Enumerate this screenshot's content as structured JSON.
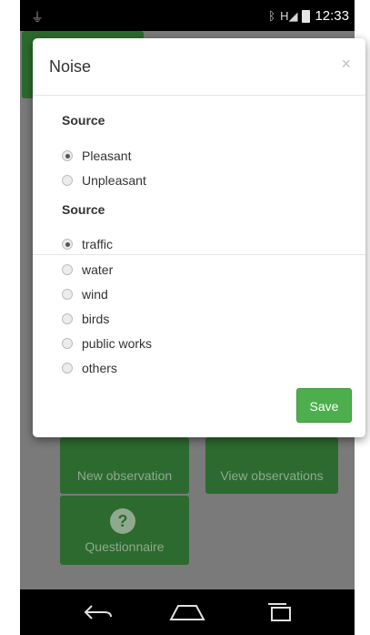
{
  "status_bar": {
    "time": "12:33",
    "icons": [
      "usb-icon",
      "bluetooth-icon",
      "signal-icon",
      "battery-icon"
    ],
    "signal_text": "H"
  },
  "dialog": {
    "title": "Noise",
    "close_glyph": "×",
    "sections": [
      {
        "label": "Source",
        "options": [
          {
            "label": "Pleasant",
            "checked": true
          },
          {
            "label": "Unpleasant",
            "checked": false
          }
        ]
      },
      {
        "label": "Source",
        "options": [
          {
            "label": "traffic",
            "checked": true
          },
          {
            "label": "water",
            "checked": false
          },
          {
            "label": "wind",
            "checked": false
          },
          {
            "label": "birds",
            "checked": false
          },
          {
            "label": "public works",
            "checked": false
          },
          {
            "label": "others",
            "checked": false
          }
        ]
      }
    ],
    "save_label": "Save"
  },
  "background": {
    "tiles": [
      {
        "label": "New observation"
      },
      {
        "label": "View observations"
      },
      {
        "label": "Questionnaire",
        "icon": "question-icon"
      }
    ]
  },
  "nav_bar": {
    "buttons": [
      "back-icon",
      "home-icon",
      "recent-apps-icon"
    ]
  },
  "colors": {
    "accent": "#4cae4c",
    "tile": "#2d6a2f",
    "overlay_bg": "#7a7a7a"
  }
}
